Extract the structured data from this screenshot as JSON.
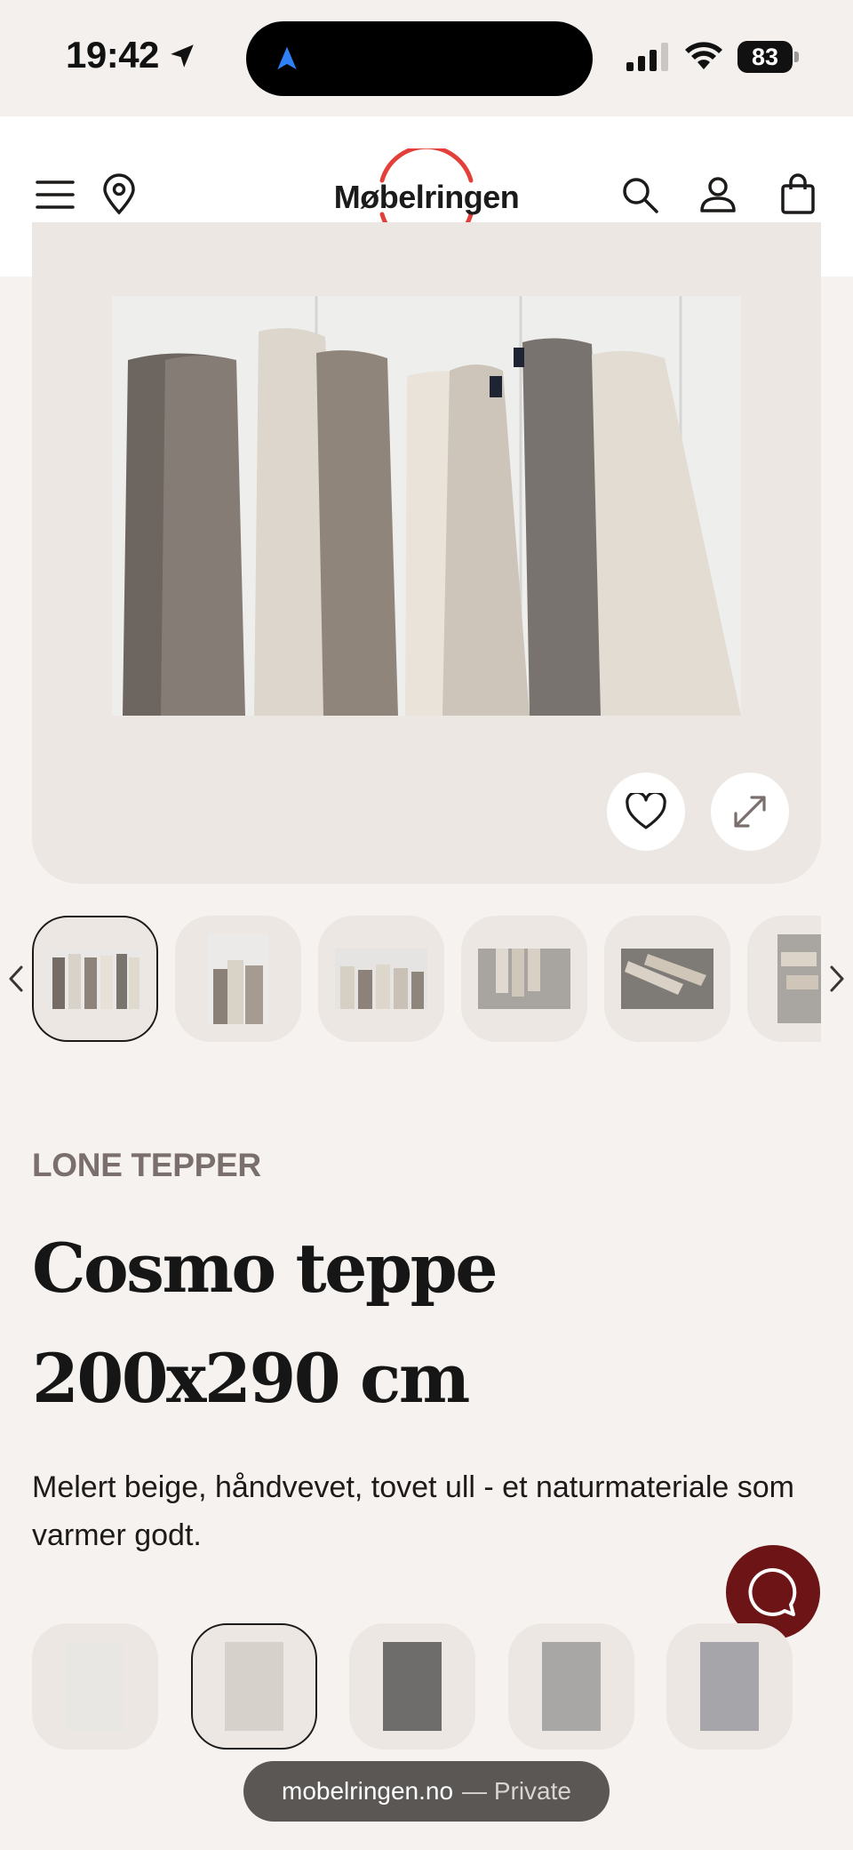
{
  "status_bar": {
    "time": "19:42",
    "battery": "83",
    "icons": [
      "location-arrow-icon",
      "navigation-icon",
      "signal-icon",
      "wifi-icon",
      "battery-icon"
    ]
  },
  "header": {
    "logo_text": "Møbelringen",
    "brand_color": "#e3403a",
    "icons": [
      "menu-icon",
      "location-pin-icon",
      "search-icon",
      "account-icon",
      "bag-icon"
    ]
  },
  "gallery": {
    "image_alt": "Rolled wool rugs leaning against a wall",
    "thumbnail_count": 6,
    "active_thumbnail": 0,
    "actions": [
      "favorite-icon",
      "expand-icon"
    ]
  },
  "product": {
    "brand": "LONE TEPPER",
    "title": "Cosmo teppe 200x290 cm",
    "description": "Melert beige, håndvevet, tovet ull - et naturmateriale som varmer godt."
  },
  "variants": {
    "colors": [
      "#e9e7e4",
      "#d7d1cc",
      "#6f6d6b",
      "#a9a7a5",
      "#a6a6aa"
    ],
    "active_index": 1
  },
  "browser": {
    "domain": "mobelringen.no",
    "mode": "— Private"
  }
}
